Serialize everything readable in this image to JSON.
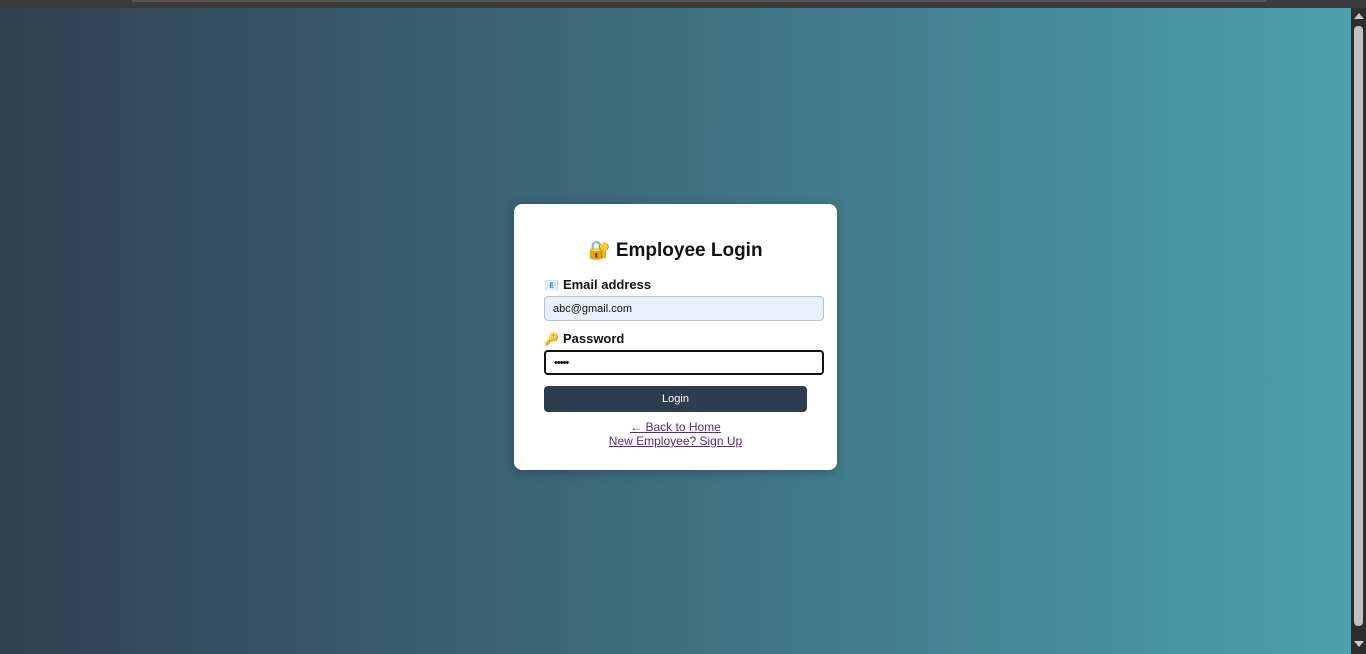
{
  "login": {
    "title": "Employee Login",
    "title_icon": "🔐",
    "email_icon": "📧",
    "email_label": "Email address",
    "email_value": "abc@gmail.com",
    "password_icon": "🔑",
    "password_label": "Password",
    "password_value": "•••••",
    "login_button": "Login",
    "back_link": "← Back to Home",
    "signup_link": "New Employee? Sign Up"
  },
  "colors": {
    "gradient_start": "#2f4052",
    "gradient_end": "#4ba0ad",
    "button": "#2e3c4f",
    "link": "#5b2a86"
  }
}
